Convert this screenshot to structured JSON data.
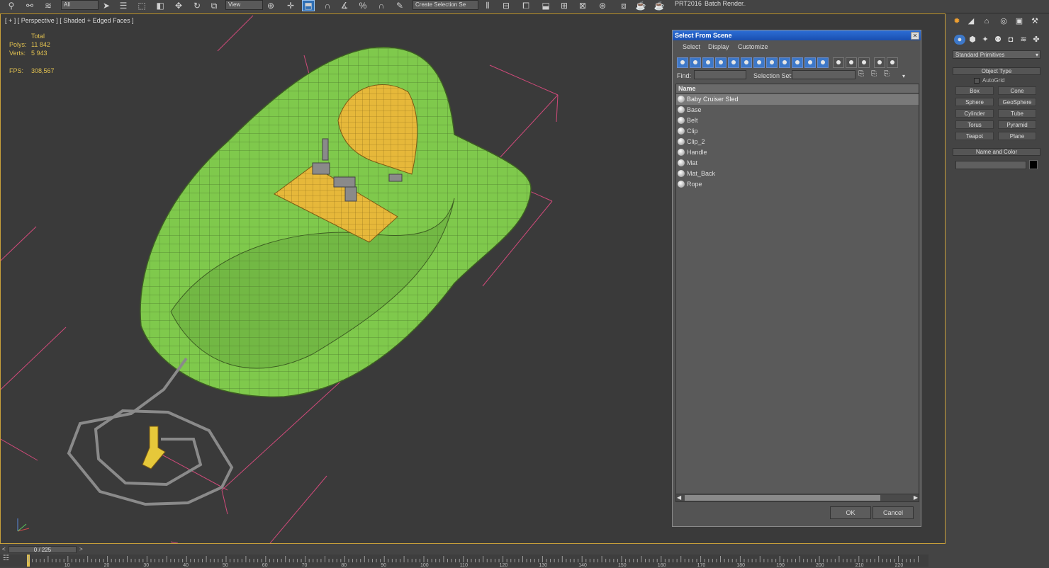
{
  "toolbar": {
    "layer_dropdown": "All",
    "view_dropdown": "View",
    "selection_set": "Create Selection Se",
    "prt_label": "PRT2016",
    "batch_render": "Batch Render..."
  },
  "viewport": {
    "label": "[ + ] [ Perspective ] [ Shaded + Edged Faces ]",
    "stats": {
      "total_label": "Total",
      "polys_label": "Polys:",
      "polys_value": "11 842",
      "verts_label": "Verts:",
      "verts_value": "5 943",
      "fps_label": "FPS:",
      "fps_value": "308,567"
    }
  },
  "dialog": {
    "title": "Select From Scene",
    "menu": [
      "Select",
      "Display",
      "Customize"
    ],
    "find_label": "Find:",
    "selection_set_label": "Selection Set:",
    "column_name": "Name",
    "items": [
      {
        "name": "Baby Cruiser Sled",
        "selected": true
      },
      {
        "name": "Base",
        "selected": false
      },
      {
        "name": "Belt",
        "selected": false
      },
      {
        "name": "Clip",
        "selected": false
      },
      {
        "name": "Clip_2",
        "selected": false
      },
      {
        "name": "Handle",
        "selected": false
      },
      {
        "name": "Mat",
        "selected": false
      },
      {
        "name": "Mat_Back",
        "selected": false
      },
      {
        "name": "Rope",
        "selected": false
      }
    ],
    "ok_label": "OK",
    "cancel_label": "Cancel"
  },
  "command_panel": {
    "category": "Standard Primitives",
    "object_type_title": "Object Type",
    "autogrid_label": "AutoGrid",
    "primitives": [
      "Box",
      "Cone",
      "Sphere",
      "GeoSphere",
      "Cylinder",
      "Tube",
      "Torus",
      "Pyramid",
      "Teapot",
      "Plane"
    ],
    "name_color_title": "Name and Color"
  },
  "timeline": {
    "frame_display": "0 / 225",
    "ticks": [
      "10",
      "20",
      "30",
      "40",
      "50",
      "60",
      "70",
      "80",
      "90",
      "100",
      "110",
      "120",
      "130",
      "140",
      "150",
      "160",
      "170",
      "180",
      "190",
      "200",
      "210",
      "220"
    ]
  },
  "colors": {
    "sled_green": "#7fc94c",
    "seat_yellow": "#e6b83a",
    "viewport_bg": "#3a3a3a",
    "title_blue": "#2c6ed6",
    "active_border": "#c9a13a"
  }
}
